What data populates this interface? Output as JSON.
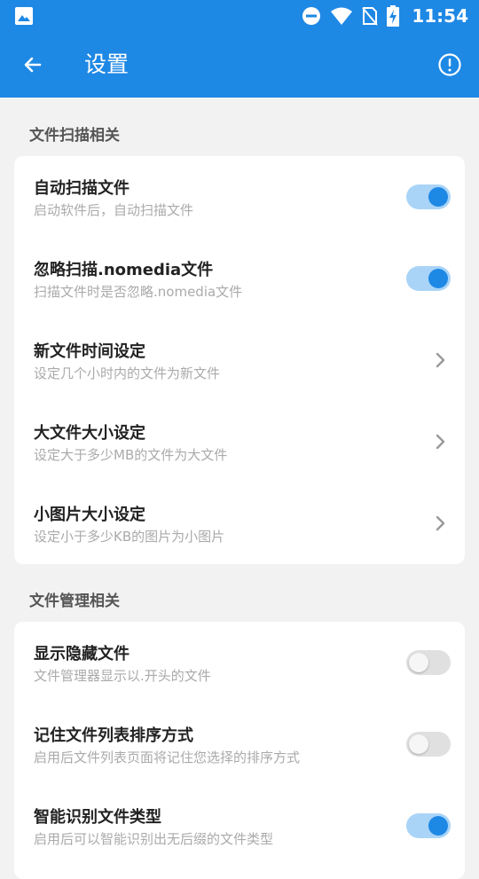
{
  "status_bar": {
    "time": "11:54",
    "icons": [
      "image-icon",
      "dnd-icon",
      "wifi-icon",
      "no-sim-icon",
      "battery-charging-icon"
    ]
  },
  "app_bar": {
    "title": "设置",
    "back_icon": "arrow-left-icon",
    "info_icon": "info-icon"
  },
  "colors": {
    "primary": "#1e88e5",
    "toggle_track_on": "#a9d4f7",
    "toggle_track_off": "#e0e0e0",
    "background": "#f2f2f2"
  },
  "sections": [
    {
      "title": "文件扫描相关",
      "items": [
        {
          "title": "自动扫描文件",
          "subtitle": "启动软件后，自动扫描文件",
          "control": "toggle",
          "on": true
        },
        {
          "title": "忽略扫描.nomedia文件",
          "subtitle": "扫描文件时是否忽略.nomedia文件",
          "control": "toggle",
          "on": true
        },
        {
          "title": "新文件时间设定",
          "subtitle": "设定几个小时内的文件为新文件",
          "control": "chevron"
        },
        {
          "title": "大文件大小设定",
          "subtitle": "设定大于多少MB的文件为大文件",
          "control": "chevron"
        },
        {
          "title": "小图片大小设定",
          "subtitle": "设定小于多少KB的图片为小图片",
          "control": "chevron"
        }
      ]
    },
    {
      "title": "文件管理相关",
      "items": [
        {
          "title": "显示隐藏文件",
          "subtitle": "文件管理器显示以.开头的文件",
          "control": "toggle",
          "on": false
        },
        {
          "title": "记住文件列表排序方式",
          "subtitle": "启用后文件列表页面将记住您选择的排序方式",
          "control": "toggle",
          "on": false
        },
        {
          "title": "智能识别文件类型",
          "subtitle": "启用后可以智能识别出无后缀的文件类型",
          "control": "toggle",
          "on": true
        }
      ]
    }
  ]
}
